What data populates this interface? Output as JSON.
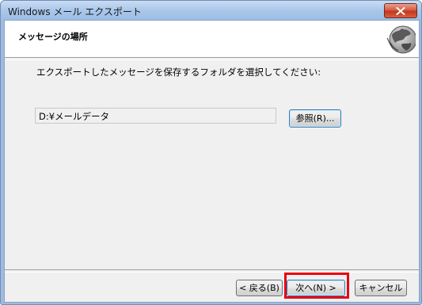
{
  "window": {
    "title": "Windows メール エクスポート"
  },
  "header": {
    "title": "メッセージの場所"
  },
  "body": {
    "instruction": "エクスポートしたメッセージを保存するフォルダを選択してください:",
    "folder_path": "D:¥メールデータ"
  },
  "buttons": {
    "browse_label": "参照(R)...",
    "back_label": "< 戻る(B)",
    "next_label": "次へ(N) >",
    "cancel_label": "キャンセル"
  },
  "icons": {
    "close": "close-icon",
    "header_image": "globe-icon"
  },
  "colors": {
    "highlight": "#e60012",
    "close_button": "#c3371d"
  }
}
